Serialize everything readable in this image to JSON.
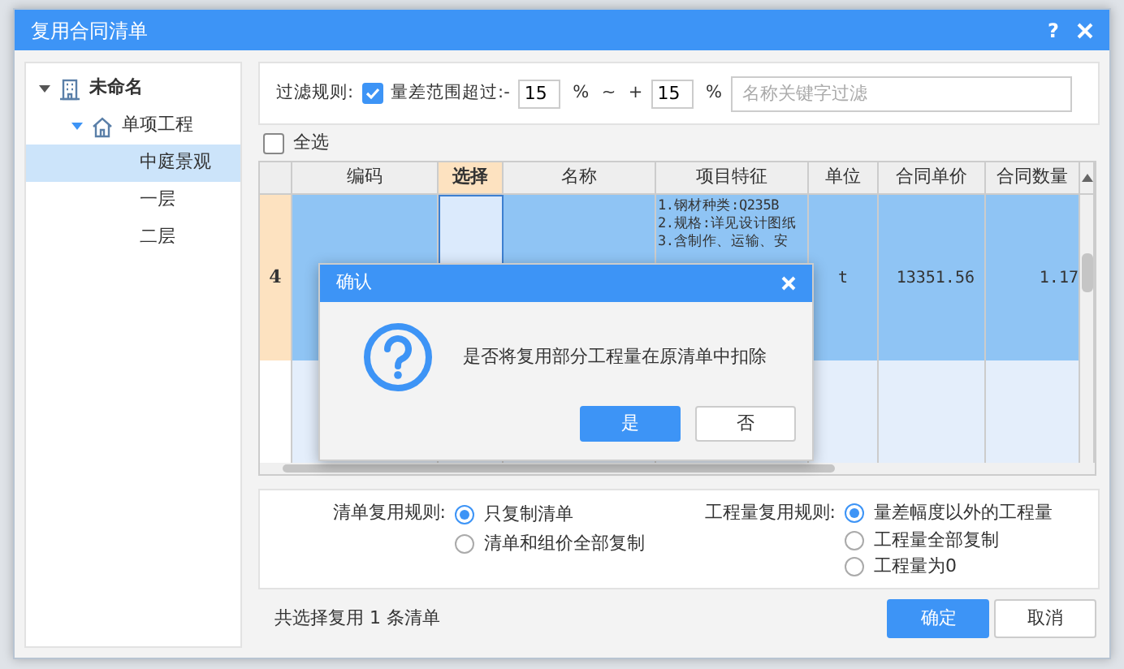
{
  "window": {
    "title": "复用合同清单",
    "help": "?"
  },
  "tree": [
    {
      "label": "未命名",
      "kind": "project",
      "expanded": true,
      "selected": false,
      "children": [
        {
          "label": "单项工程",
          "kind": "house",
          "expanded": true,
          "selected": false,
          "children": [
            {
              "label": "中庭景观",
              "selected": true
            },
            {
              "label": "一层",
              "selected": false
            },
            {
              "label": "二层",
              "selected": false
            }
          ]
        }
      ]
    }
  ],
  "filter": {
    "label": "过滤规则:",
    "checked": true,
    "checkbox_label": "量差范围超过:-",
    "min": "15",
    "percent_1": "%",
    "tilde": "~",
    "plus": "+",
    "max": "15",
    "percent_2": "%",
    "placeholder": "名称关键字过滤"
  },
  "select_all": {
    "label": "全选",
    "checked": false
  },
  "table": {
    "columns": [
      {
        "label": "编码",
        "selected": false
      },
      {
        "label": "选择",
        "selected": true
      },
      {
        "label": "名称",
        "selected": false
      },
      {
        "label": "项目特征",
        "selected": false
      },
      {
        "label": "单位",
        "selected": false
      },
      {
        "label": "合同单价",
        "selected": false
      },
      {
        "label": "合同数量",
        "selected": false
      }
    ],
    "rows": [
      {
        "number": "4",
        "selected": true,
        "features": [
          "1.钢材种类:Q235B",
          "2.规格:详见设计图纸",
          "3.含制作、运输、安"
        ],
        "unit": "t",
        "unit_price": "13351.56",
        "quantity": "1.17"
      }
    ]
  },
  "reuse_rule": {
    "label": "清单复用规则:",
    "options": [
      {
        "label": "只复制清单",
        "selected": true
      },
      {
        "label": "清单和组价全部复制",
        "selected": false
      }
    ]
  },
  "quantity_rule": {
    "label": "工程量复用规则:",
    "options": [
      {
        "label": "量差幅度以外的工程量",
        "selected": true
      },
      {
        "label": "工程量全部复制",
        "selected": false
      },
      {
        "label": "工程量为0",
        "selected": false
      }
    ]
  },
  "summary": "共选择复用 1 条清单",
  "buttons": [
    {
      "label": "确定",
      "kind": "primary"
    },
    {
      "label": "取消",
      "kind": "secondary"
    }
  ],
  "confirm": {
    "title": "确认",
    "message": "是否将复用部分工程量在原清单中扣除",
    "buttons": [
      {
        "label": "是",
        "kind": "primary"
      },
      {
        "label": "否",
        "kind": "secondary"
      }
    ]
  }
}
